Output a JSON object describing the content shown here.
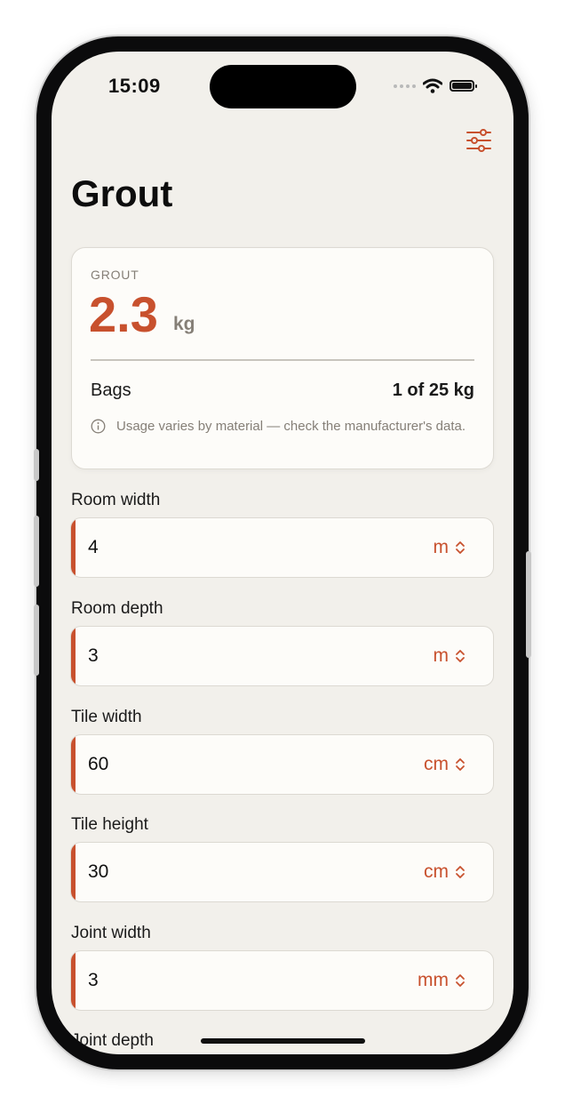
{
  "status_bar": {
    "time": "15:09"
  },
  "page": {
    "title": "Grout"
  },
  "result": {
    "label": "GROUT",
    "value": "2.3",
    "unit": "kg",
    "bags_label": "Bags",
    "bags_value": "1 of 25 kg",
    "note": "Usage varies by material — check the manufacturer's data."
  },
  "fields": [
    {
      "label": "Room width",
      "value": "4",
      "unit": "m"
    },
    {
      "label": "Room depth",
      "value": "3",
      "unit": "m"
    },
    {
      "label": "Tile width",
      "value": "60",
      "unit": "cm"
    },
    {
      "label": "Tile height",
      "value": "30",
      "unit": "cm"
    },
    {
      "label": "Joint width",
      "value": "3",
      "unit": "mm"
    },
    {
      "label": "Joint depth"
    }
  ],
  "colors": {
    "accent": "#c8512e",
    "background": "#f2f0eb",
    "card": "#fdfcf9",
    "muted": "#857f77"
  },
  "icons": {
    "settings": "sliders-icon",
    "info": "info-circle-icon",
    "unit_picker": "chevron-up-down-icon"
  }
}
